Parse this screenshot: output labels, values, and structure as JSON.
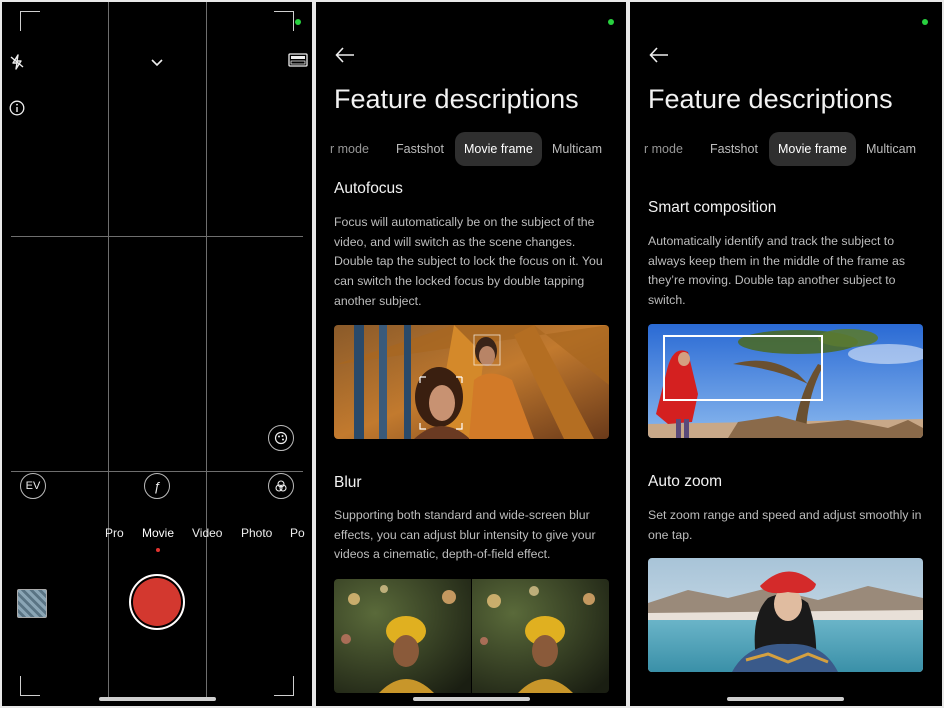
{
  "camera": {
    "mode_labels": [
      "Pro",
      "Movie",
      "Video",
      "Photo",
      "Po"
    ],
    "active_mode": "Movie",
    "ev_label": "EV",
    "aperture_label": "ƒ",
    "icons": {
      "flash": "flash-off-icon",
      "chevron": "chevron-down-icon",
      "info": "info-icon",
      "cinema": "cinema-ratio-icon",
      "filter": "filter-icon",
      "beauty": "color-circles-icon",
      "palette": "palette-icon"
    },
    "shutter_color": "#d3382f"
  },
  "features_page_1": {
    "title": "Feature descriptions",
    "tabs": [
      "r mode",
      "Fastshot",
      "Movie frame",
      "Multicam"
    ],
    "active_tab": "Movie frame",
    "sections": [
      {
        "heading": "Autofocus",
        "body": "Focus will automatically be on the subject of the video, and will switch as the scene changes. Double tap the subject to lock the focus on it. You can switch the locked focus by double tapping another subject."
      },
      {
        "heading": "Blur",
        "body": "Supporting both standard and wide-screen blur effects, you can adjust blur intensity to give your videos a cinematic, depth-of-field effect."
      }
    ]
  },
  "features_page_2": {
    "title": "Feature descriptions",
    "tabs": [
      "r mode",
      "Fastshot",
      "Movie frame",
      "Multicam"
    ],
    "active_tab": "Movie frame",
    "sections": [
      {
        "heading": "Smart composition",
        "body": "Automatically identify and track the subject to always keep them in the middle of the frame as they’re moving. Double tap another subject to switch."
      },
      {
        "heading": "Auto zoom",
        "body": "Set zoom range and speed and adjust smoothly in one tap."
      }
    ]
  },
  "colors": {
    "accent_green": "#28d13f",
    "tab_active_bg": "#2f2f2f",
    "record_red": "#d3382f"
  }
}
